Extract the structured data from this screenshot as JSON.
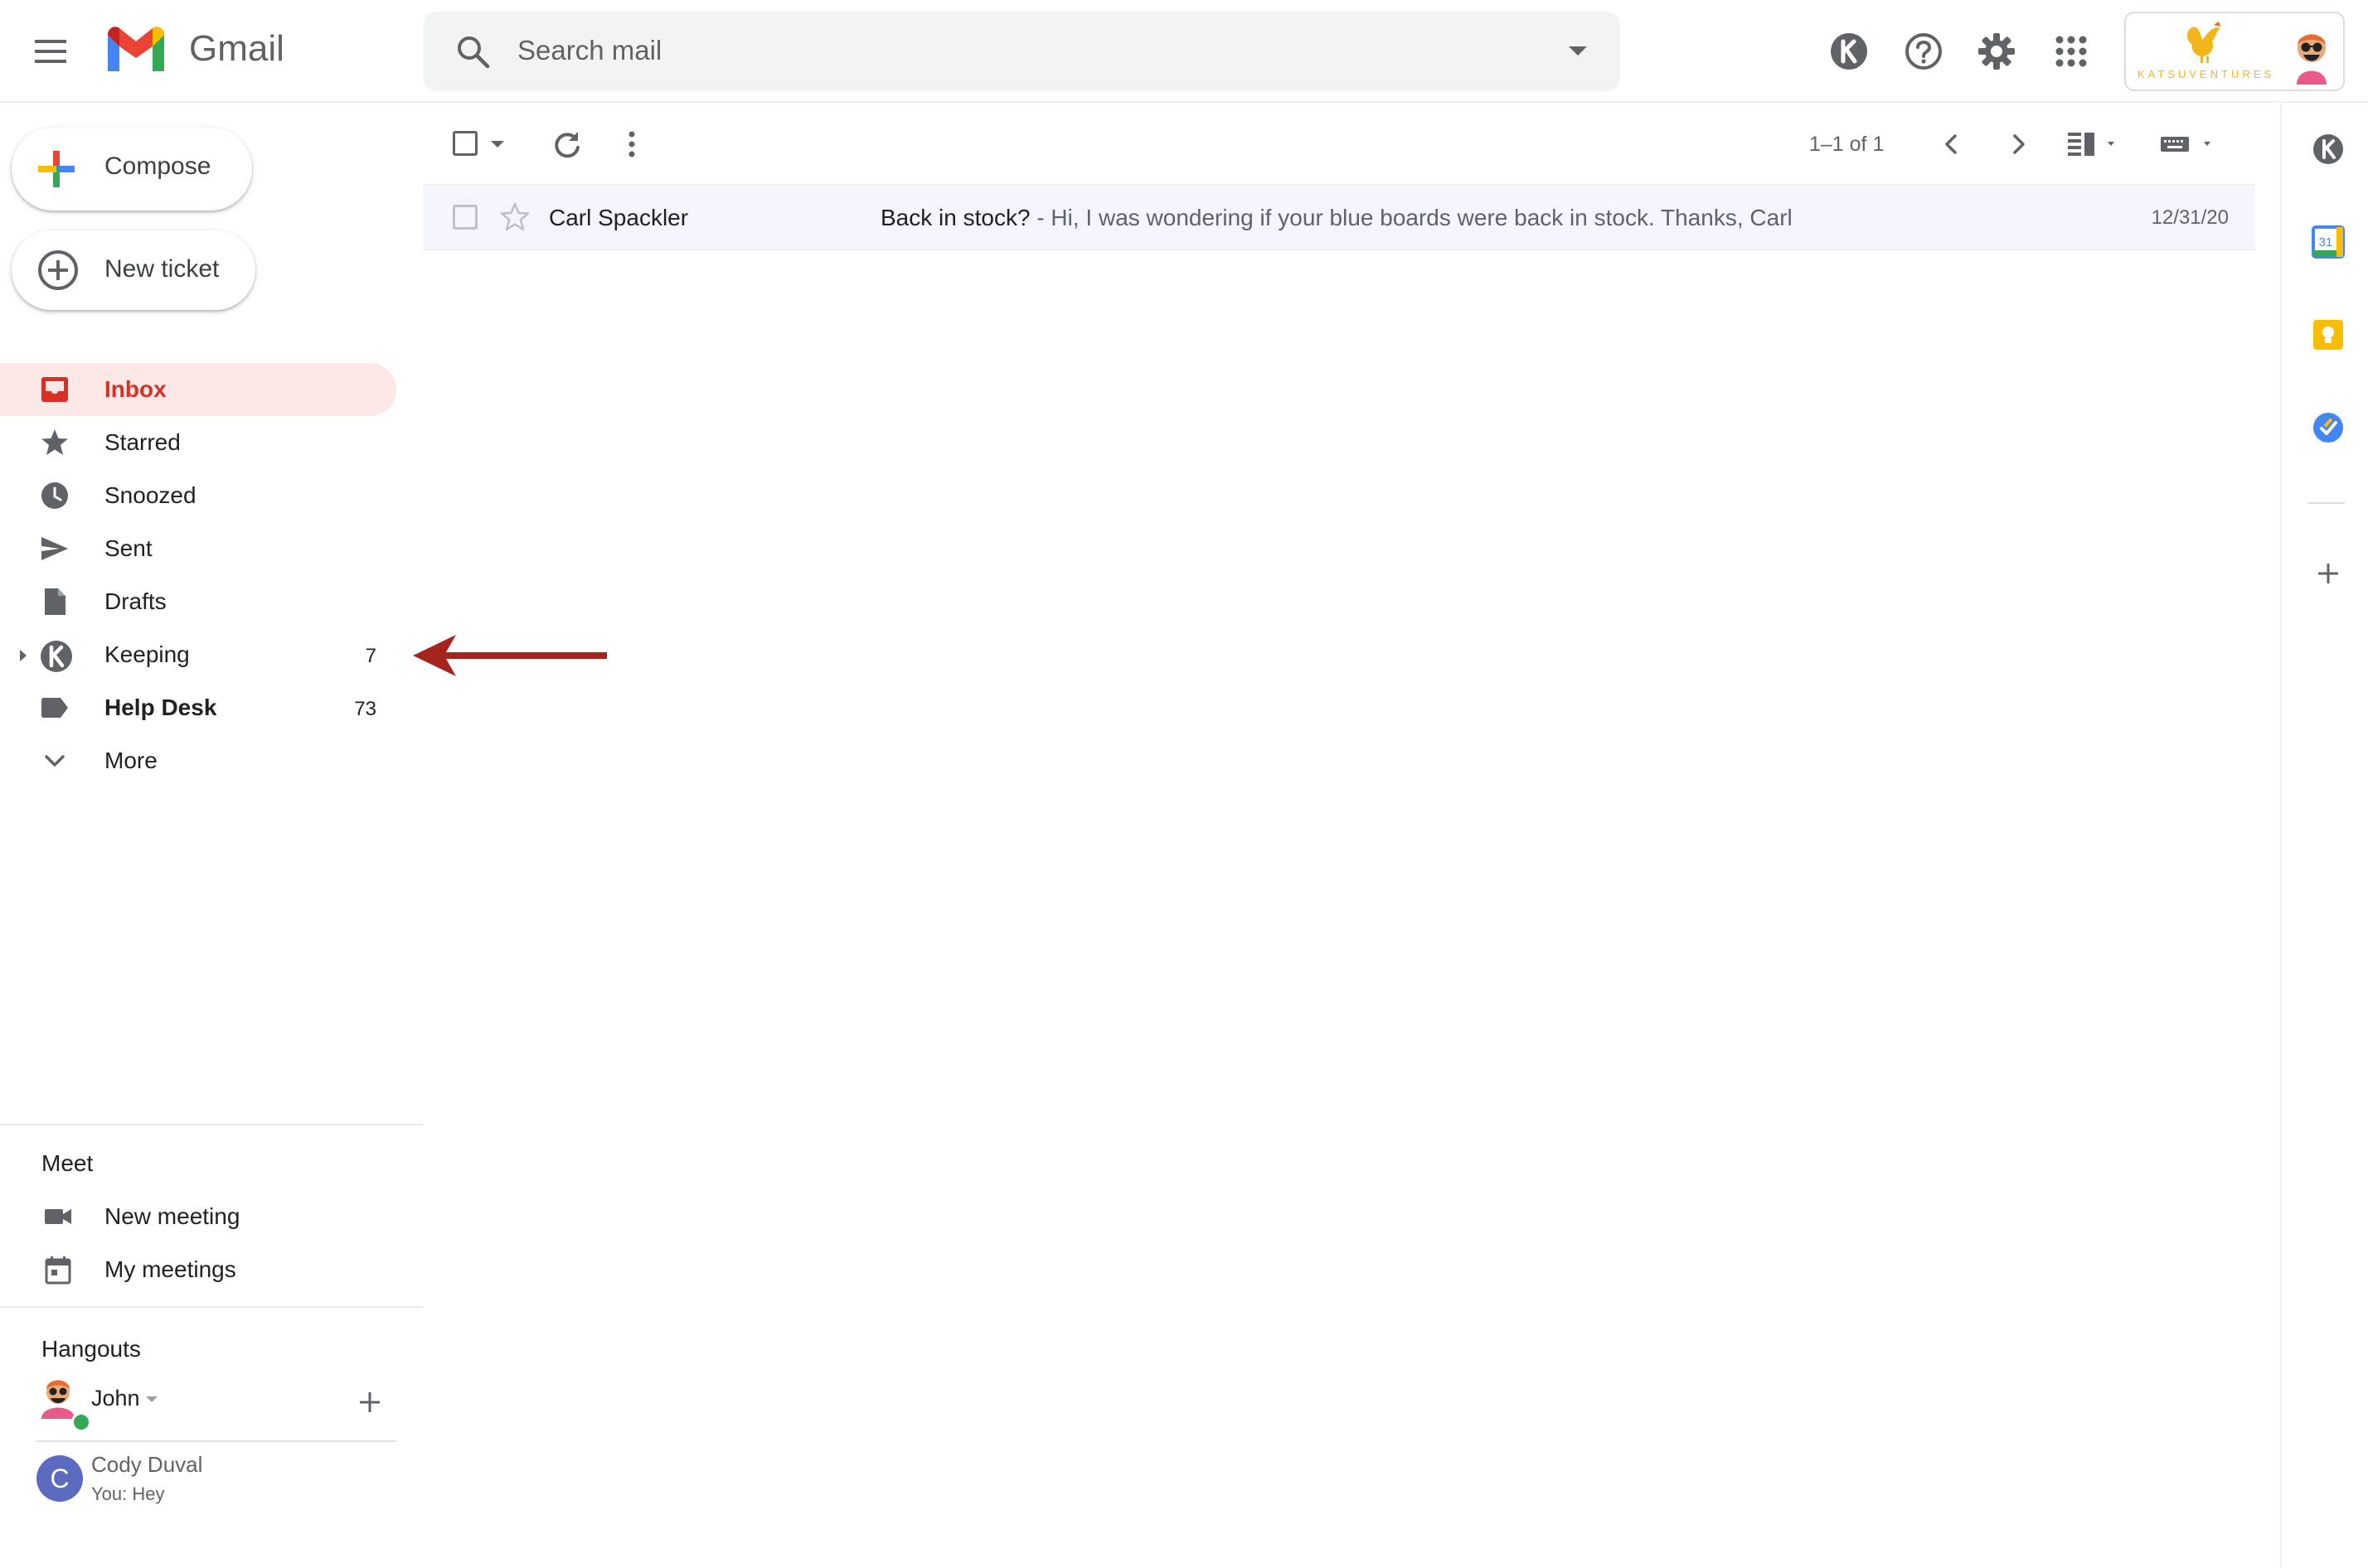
{
  "app": {
    "name": "Gmail",
    "brand_colors": {
      "red": "#ea4335",
      "blue": "#4285f4",
      "green": "#34a853",
      "yellow": "#fbbc04",
      "active_red": "#d93025",
      "arrow_red": "#a7231d"
    }
  },
  "header": {
    "search": {
      "placeholder": "Search mail"
    },
    "icons": [
      "keeping-icon",
      "help-icon",
      "settings-gear-icon",
      "apps-grid-icon"
    ],
    "account_logo_text": "KATSUVENTURES"
  },
  "sidebar": {
    "compose_label": "Compose",
    "new_ticket_label": "New ticket",
    "items": [
      {
        "label": "Inbox",
        "icon": "inbox-icon",
        "active": true
      },
      {
        "label": "Starred",
        "icon": "star-icon"
      },
      {
        "label": "Snoozed",
        "icon": "clock-icon"
      },
      {
        "label": "Sent",
        "icon": "send-icon"
      },
      {
        "label": "Drafts",
        "icon": "draft-icon"
      },
      {
        "label": "Keeping",
        "icon": "keeping-icon",
        "count": "7"
      },
      {
        "label": "Help Desk",
        "icon": "label-icon",
        "count": "73"
      },
      {
        "label": "More",
        "icon": "chevron-down-icon"
      }
    ]
  },
  "meet": {
    "title": "Meet",
    "items": [
      {
        "label": "New meeting",
        "icon": "video-camera-icon"
      },
      {
        "label": "My meetings",
        "icon": "calendar-icon"
      }
    ]
  },
  "hangouts": {
    "title": "Hangouts",
    "user_name": "John",
    "contacts": [
      {
        "initial": "C",
        "name": "Cody Duval",
        "last_message": "You: Hey"
      }
    ]
  },
  "toolbar": {
    "pagination": "1–1 of 1"
  },
  "emails": [
    {
      "sender": "Carl Spackler",
      "subject": "Back in stock?",
      "snippet": " - Hi, I was wondering if your blue boards were back in stock. Thanks, Carl",
      "date": "12/31/20"
    }
  ],
  "side_panel": {
    "icons": [
      "keeping-icon",
      "calendar-icon",
      "keep-notes-icon",
      "tasks-icon",
      "add-icon"
    ],
    "calendar_day": "31"
  }
}
